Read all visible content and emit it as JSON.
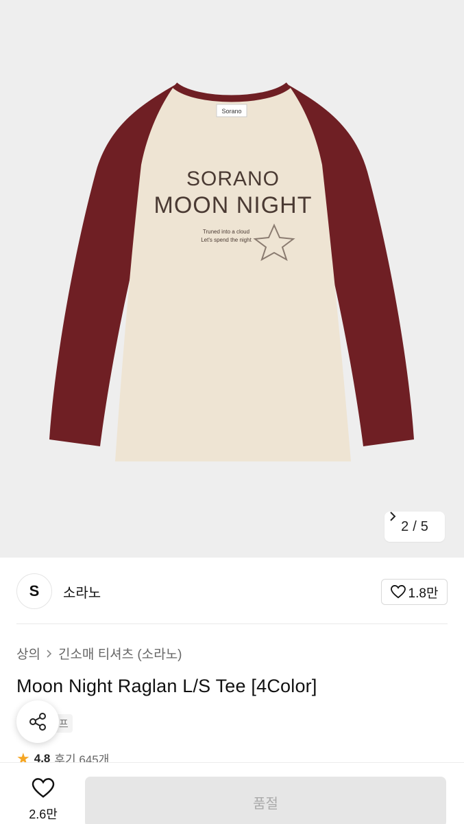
{
  "gallery": {
    "current": "2",
    "separator": "/",
    "total": "5",
    "next_icon": "chevron-right-icon",
    "print": {
      "line1": "SORANO",
      "line2": "MOON NIGHT",
      "small1": "Truned into a cloud",
      "small2": "Let's spend the night",
      "neck_label": "Sorano"
    }
  },
  "brand": {
    "logo_letter": "S",
    "name": "소라노",
    "like_count": "1.8만"
  },
  "breadcrumb": {
    "level1": "상의",
    "level2": "긴소매 티셔츠 (소라노)"
  },
  "product": {
    "title": "Moon Night Raglan L/S Tee [4Color]",
    "tag": "프"
  },
  "rating": {
    "score": "4.8",
    "reviews": "후기 645개"
  },
  "bottom": {
    "wish_count": "2.6만",
    "buy_label": "품절"
  },
  "colors": {
    "hero_bg": "#eeeeee",
    "body_color": "#eee4d3",
    "sleeve_color": "#6f1f24",
    "star_color": "#f5a623"
  }
}
